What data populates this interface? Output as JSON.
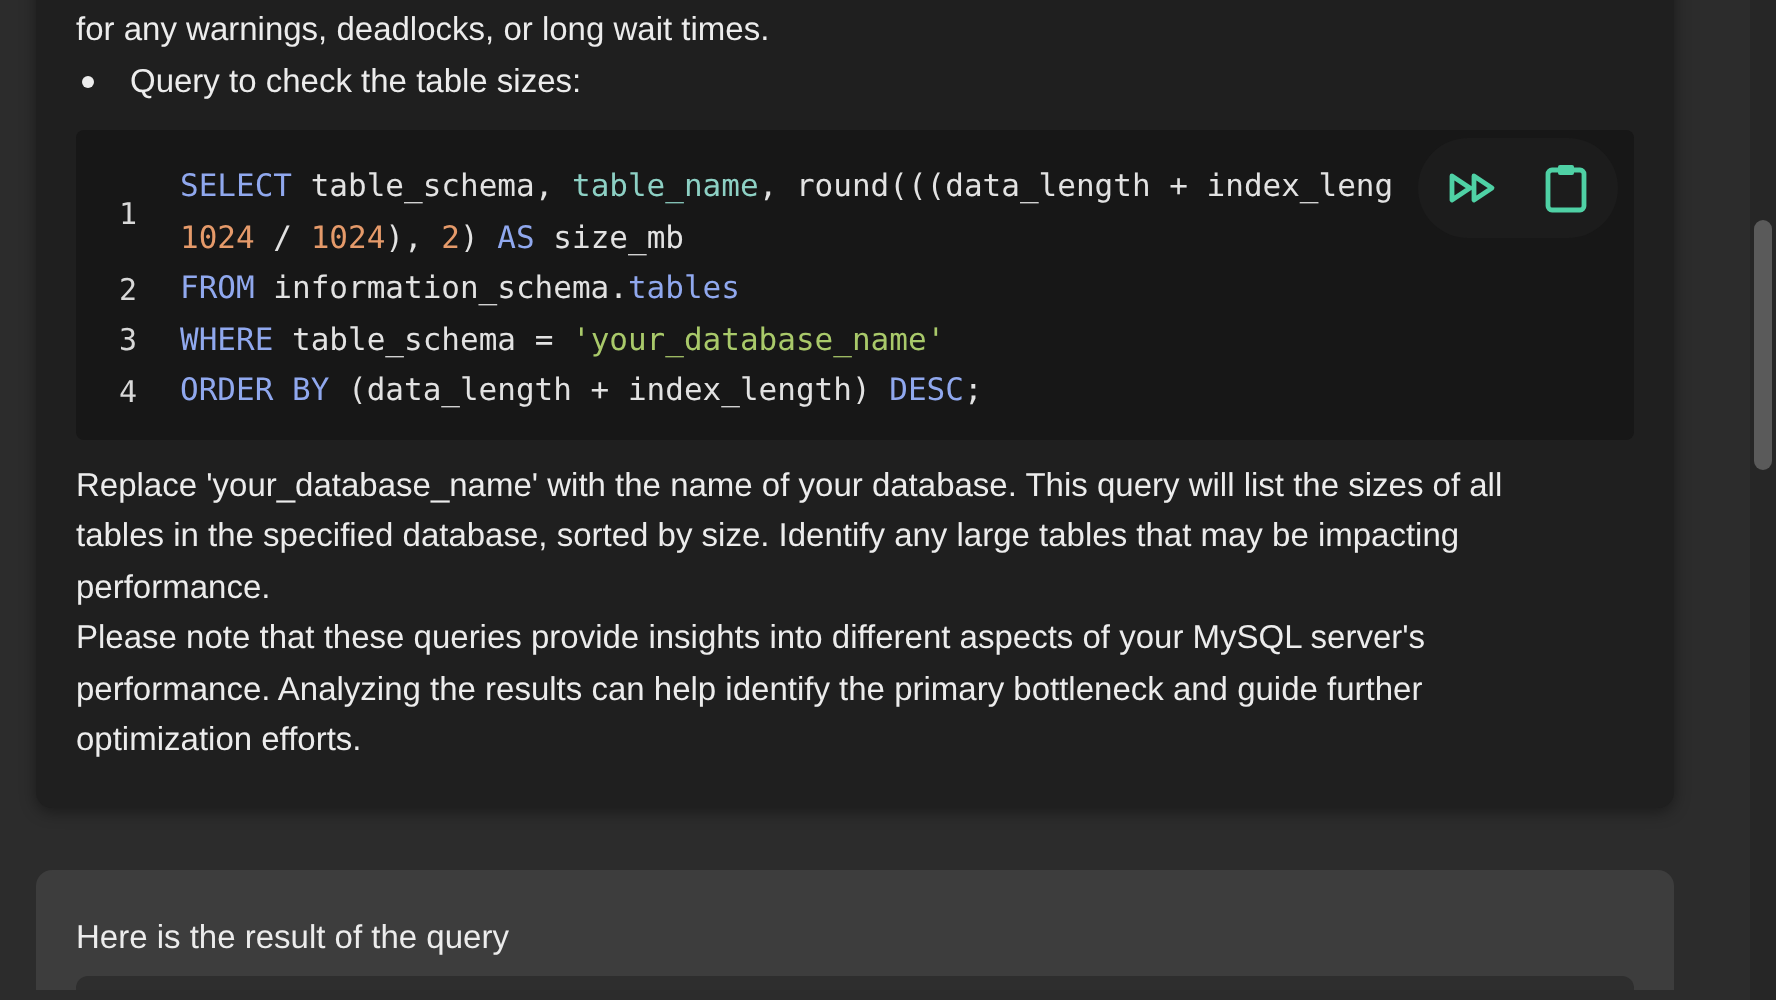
{
  "answer": {
    "lines": [
      {
        "kind": "text",
        "text": "for any warnings, deadlocks, or long wait times."
      },
      {
        "kind": "bullet",
        "text": "Query to check the table sizes:"
      }
    ],
    "code": {
      "lines": [
        {
          "number": "1",
          "tokens": [
            {
              "kind": "keyword",
              "text": "SELECT"
            },
            {
              "kind": "plain",
              "text": " table_schema, "
            },
            {
              "kind": "name",
              "text": "table_name"
            },
            {
              "kind": "plain",
              "text": ", round(((data_length + index_leng"
            },
            {
              "kind": "break"
            },
            {
              "kind": "number",
              "text": "1024"
            },
            {
              "kind": "plain",
              "text": " / "
            },
            {
              "kind": "number",
              "text": "1024"
            },
            {
              "kind": "plain",
              "text": "), "
            },
            {
              "kind": "number",
              "text": "2"
            },
            {
              "kind": "plain",
              "text": ") "
            },
            {
              "kind": "keyword",
              "text": "AS"
            },
            {
              "kind": "plain",
              "text": " size_mb"
            }
          ]
        },
        {
          "number": "2",
          "tokens": [
            {
              "kind": "keyword",
              "text": "FROM"
            },
            {
              "kind": "plain",
              "text": " information_schema."
            },
            {
              "kind": "keyword",
              "text": "tables"
            }
          ]
        },
        {
          "number": "3",
          "tokens": [
            {
              "kind": "keyword",
              "text": "WHERE"
            },
            {
              "kind": "plain",
              "text": " table_schema = "
            },
            {
              "kind": "string",
              "text": "'your_database_name'"
            }
          ]
        },
        {
          "number": "4",
          "tokens": [
            {
              "kind": "keyword",
              "text": "ORDER BY"
            },
            {
              "kind": "plain",
              "text": " (data_length + index_length) "
            },
            {
              "kind": "keyword",
              "text": "DESC"
            },
            {
              "kind": "plain",
              "text": ";"
            }
          ]
        }
      ]
    },
    "paragraphs": [
      "Replace 'your_database_name' with the name of your database. This query will list the sizes of all tables in the specified database, sorted by size. Identify any large tables that may be impacting performance.",
      "Please note that these queries provide insights into different aspects of your MySQL server's performance. Analyzing the results can help identify the primary bottleneck and guide further optimization efforts."
    ]
  },
  "prompt": {
    "text": "Here is the result of the query"
  }
}
